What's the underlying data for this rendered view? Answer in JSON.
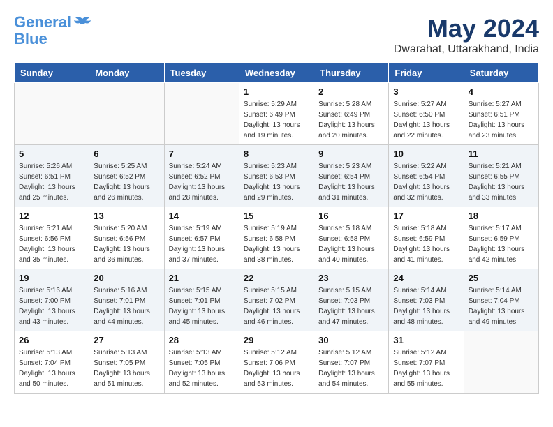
{
  "logo": {
    "line1": "General",
    "line2": "Blue"
  },
  "title": "May 2024",
  "location": "Dwarahat, Uttarakhand, India",
  "days_of_week": [
    "Sunday",
    "Monday",
    "Tuesday",
    "Wednesday",
    "Thursday",
    "Friday",
    "Saturday"
  ],
  "weeks": [
    [
      {
        "day": "",
        "info": ""
      },
      {
        "day": "",
        "info": ""
      },
      {
        "day": "",
        "info": ""
      },
      {
        "day": "1",
        "info": "Sunrise: 5:29 AM\nSunset: 6:49 PM\nDaylight: 13 hours\nand 19 minutes."
      },
      {
        "day": "2",
        "info": "Sunrise: 5:28 AM\nSunset: 6:49 PM\nDaylight: 13 hours\nand 20 minutes."
      },
      {
        "day": "3",
        "info": "Sunrise: 5:27 AM\nSunset: 6:50 PM\nDaylight: 13 hours\nand 22 minutes."
      },
      {
        "day": "4",
        "info": "Sunrise: 5:27 AM\nSunset: 6:51 PM\nDaylight: 13 hours\nand 23 minutes."
      }
    ],
    [
      {
        "day": "5",
        "info": "Sunrise: 5:26 AM\nSunset: 6:51 PM\nDaylight: 13 hours\nand 25 minutes."
      },
      {
        "day": "6",
        "info": "Sunrise: 5:25 AM\nSunset: 6:52 PM\nDaylight: 13 hours\nand 26 minutes."
      },
      {
        "day": "7",
        "info": "Sunrise: 5:24 AM\nSunset: 6:52 PM\nDaylight: 13 hours\nand 28 minutes."
      },
      {
        "day": "8",
        "info": "Sunrise: 5:23 AM\nSunset: 6:53 PM\nDaylight: 13 hours\nand 29 minutes."
      },
      {
        "day": "9",
        "info": "Sunrise: 5:23 AM\nSunset: 6:54 PM\nDaylight: 13 hours\nand 31 minutes."
      },
      {
        "day": "10",
        "info": "Sunrise: 5:22 AM\nSunset: 6:54 PM\nDaylight: 13 hours\nand 32 minutes."
      },
      {
        "day": "11",
        "info": "Sunrise: 5:21 AM\nSunset: 6:55 PM\nDaylight: 13 hours\nand 33 minutes."
      }
    ],
    [
      {
        "day": "12",
        "info": "Sunrise: 5:21 AM\nSunset: 6:56 PM\nDaylight: 13 hours\nand 35 minutes."
      },
      {
        "day": "13",
        "info": "Sunrise: 5:20 AM\nSunset: 6:56 PM\nDaylight: 13 hours\nand 36 minutes."
      },
      {
        "day": "14",
        "info": "Sunrise: 5:19 AM\nSunset: 6:57 PM\nDaylight: 13 hours\nand 37 minutes."
      },
      {
        "day": "15",
        "info": "Sunrise: 5:19 AM\nSunset: 6:58 PM\nDaylight: 13 hours\nand 38 minutes."
      },
      {
        "day": "16",
        "info": "Sunrise: 5:18 AM\nSunset: 6:58 PM\nDaylight: 13 hours\nand 40 minutes."
      },
      {
        "day": "17",
        "info": "Sunrise: 5:18 AM\nSunset: 6:59 PM\nDaylight: 13 hours\nand 41 minutes."
      },
      {
        "day": "18",
        "info": "Sunrise: 5:17 AM\nSunset: 6:59 PM\nDaylight: 13 hours\nand 42 minutes."
      }
    ],
    [
      {
        "day": "19",
        "info": "Sunrise: 5:16 AM\nSunset: 7:00 PM\nDaylight: 13 hours\nand 43 minutes."
      },
      {
        "day": "20",
        "info": "Sunrise: 5:16 AM\nSunset: 7:01 PM\nDaylight: 13 hours\nand 44 minutes."
      },
      {
        "day": "21",
        "info": "Sunrise: 5:15 AM\nSunset: 7:01 PM\nDaylight: 13 hours\nand 45 minutes."
      },
      {
        "day": "22",
        "info": "Sunrise: 5:15 AM\nSunset: 7:02 PM\nDaylight: 13 hours\nand 46 minutes."
      },
      {
        "day": "23",
        "info": "Sunrise: 5:15 AM\nSunset: 7:03 PM\nDaylight: 13 hours\nand 47 minutes."
      },
      {
        "day": "24",
        "info": "Sunrise: 5:14 AM\nSunset: 7:03 PM\nDaylight: 13 hours\nand 48 minutes."
      },
      {
        "day": "25",
        "info": "Sunrise: 5:14 AM\nSunset: 7:04 PM\nDaylight: 13 hours\nand 49 minutes."
      }
    ],
    [
      {
        "day": "26",
        "info": "Sunrise: 5:13 AM\nSunset: 7:04 PM\nDaylight: 13 hours\nand 50 minutes."
      },
      {
        "day": "27",
        "info": "Sunrise: 5:13 AM\nSunset: 7:05 PM\nDaylight: 13 hours\nand 51 minutes."
      },
      {
        "day": "28",
        "info": "Sunrise: 5:13 AM\nSunset: 7:05 PM\nDaylight: 13 hours\nand 52 minutes."
      },
      {
        "day": "29",
        "info": "Sunrise: 5:12 AM\nSunset: 7:06 PM\nDaylight: 13 hours\nand 53 minutes."
      },
      {
        "day": "30",
        "info": "Sunrise: 5:12 AM\nSunset: 7:07 PM\nDaylight: 13 hours\nand 54 minutes."
      },
      {
        "day": "31",
        "info": "Sunrise: 5:12 AM\nSunset: 7:07 PM\nDaylight: 13 hours\nand 55 minutes."
      },
      {
        "day": "",
        "info": ""
      }
    ]
  ]
}
